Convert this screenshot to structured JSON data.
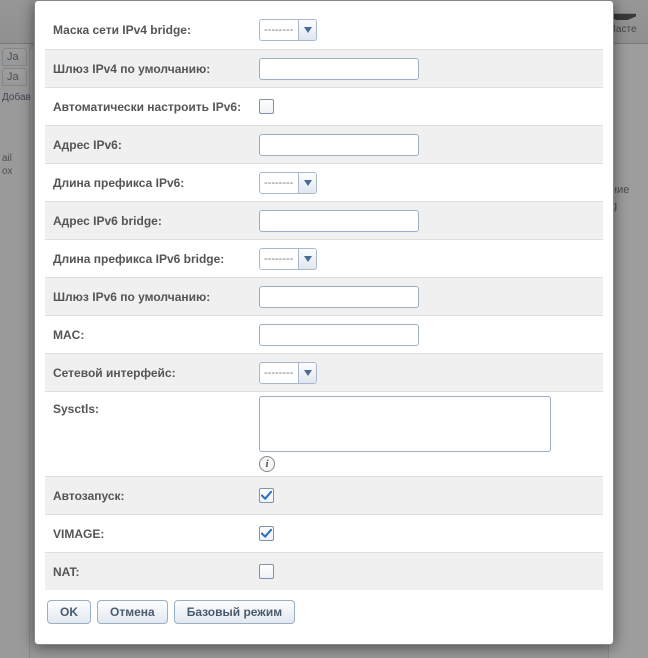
{
  "background": {
    "hat_label": "Масте",
    "left_tab1": "Ja",
    "left_tab2": "Ja",
    "left_add": "Добав",
    "left_tab_ail": "ail",
    "left_tab_ox": "ox",
    "right_txt1": "ние",
    "right_txt2": "g"
  },
  "form": {
    "rows": [
      {
        "label": "Маска сети IPv4 bridge:",
        "type": "combo",
        "value": "---------",
        "alt": false
      },
      {
        "label": "Шлюз IPv4 по умолчанию:",
        "type": "text",
        "value": "",
        "alt": true
      },
      {
        "label": "Автоматически настроить IPv6:",
        "type": "checkbox",
        "checked": false,
        "alt": false
      },
      {
        "label": "Адрес IPv6:",
        "type": "text",
        "value": "",
        "alt": true
      },
      {
        "label": "Длина префикса IPv6:",
        "type": "combo",
        "value": "---------",
        "alt": false
      },
      {
        "label": "Адрес IPv6 bridge:",
        "type": "text",
        "value": "",
        "alt": true
      },
      {
        "label": "Длина префикса IPv6 bridge:",
        "type": "combo",
        "value": "---------",
        "alt": false
      },
      {
        "label": "Шлюз IPv6 по умолчанию:",
        "type": "text",
        "value": "",
        "alt": true
      },
      {
        "label": "MAC:",
        "type": "text",
        "value": "",
        "alt": false
      },
      {
        "label": "Сетевой интерфейс:",
        "type": "combo",
        "value": "---------",
        "alt": true
      },
      {
        "label": "Sysctls:",
        "type": "textarea",
        "value": "",
        "alt": false,
        "info": true
      },
      {
        "label": "Автозапуск:",
        "type": "checkbox",
        "checked": true,
        "alt": true
      },
      {
        "label": "VIMAGE:",
        "type": "checkbox",
        "checked": true,
        "alt": false
      },
      {
        "label": "NAT:",
        "type": "checkbox",
        "checked": false,
        "alt": true
      }
    ],
    "buttons": {
      "ok": "OK",
      "cancel": "Отмена",
      "basic": "Базовый режим"
    }
  },
  "icons": {
    "info": "i"
  }
}
